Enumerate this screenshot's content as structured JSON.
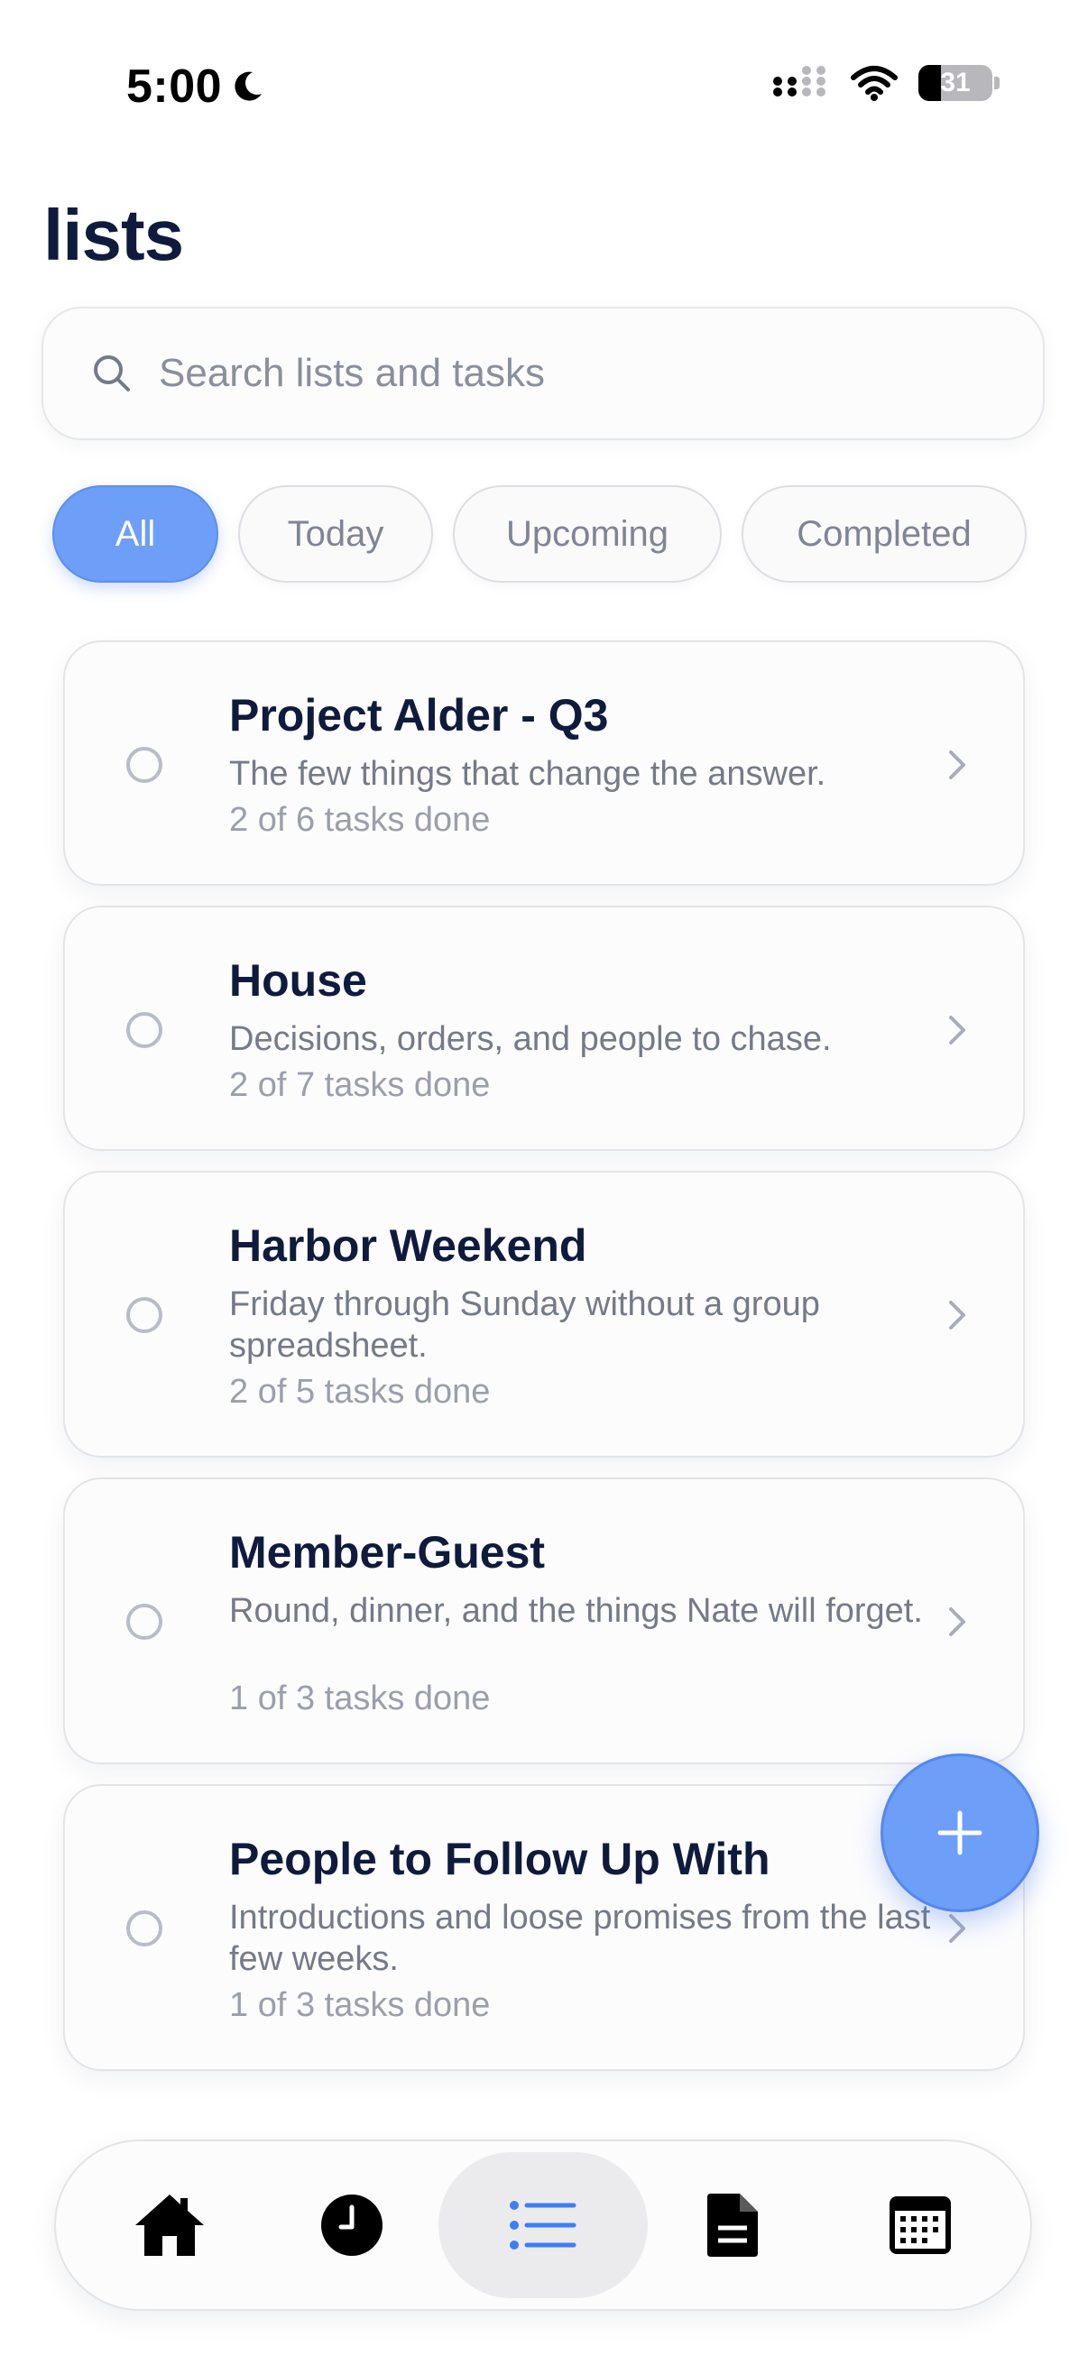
{
  "status_bar": {
    "time": "5:00",
    "battery_level": "31"
  },
  "page": {
    "title": "lists"
  },
  "search": {
    "placeholder": "Search lists and tasks",
    "value": ""
  },
  "filters": [
    {
      "label": "All",
      "active": true
    },
    {
      "label": "Today",
      "active": false
    },
    {
      "label": "Upcoming",
      "active": false
    },
    {
      "label": "Completed",
      "active": false
    }
  ],
  "lists": [
    {
      "title": "Project Alder - Q3",
      "description": "The few things that change the answer.",
      "progress": "2 of 6 tasks done"
    },
    {
      "title": "House",
      "description": "Decisions, orders, and people to chase.",
      "progress": "2 of 7 tasks done"
    },
    {
      "title": "Harbor Weekend",
      "description": "Friday through Sunday without a group spreadsheet.",
      "progress": "2 of 5 tasks done"
    },
    {
      "title": "Member-Guest",
      "description": "Round, dinner, and the things Nate will forget.",
      "progress": "1 of 3 tasks done"
    },
    {
      "title": "People to Follow Up With",
      "description": "Introductions and loose promises from the last few weeks.",
      "progress": "1 of 3 tasks done"
    }
  ],
  "tab_bar": {
    "items": [
      {
        "icon": "home-icon",
        "active": false
      },
      {
        "icon": "clock-icon",
        "active": false
      },
      {
        "icon": "list-icon",
        "active": true
      },
      {
        "icon": "document-icon",
        "active": false
      },
      {
        "icon": "calendar-icon",
        "active": false
      }
    ]
  },
  "colors": {
    "accent": "#6d9ef8",
    "title_text": "#0f1b3d",
    "secondary_text": "#747a88"
  }
}
